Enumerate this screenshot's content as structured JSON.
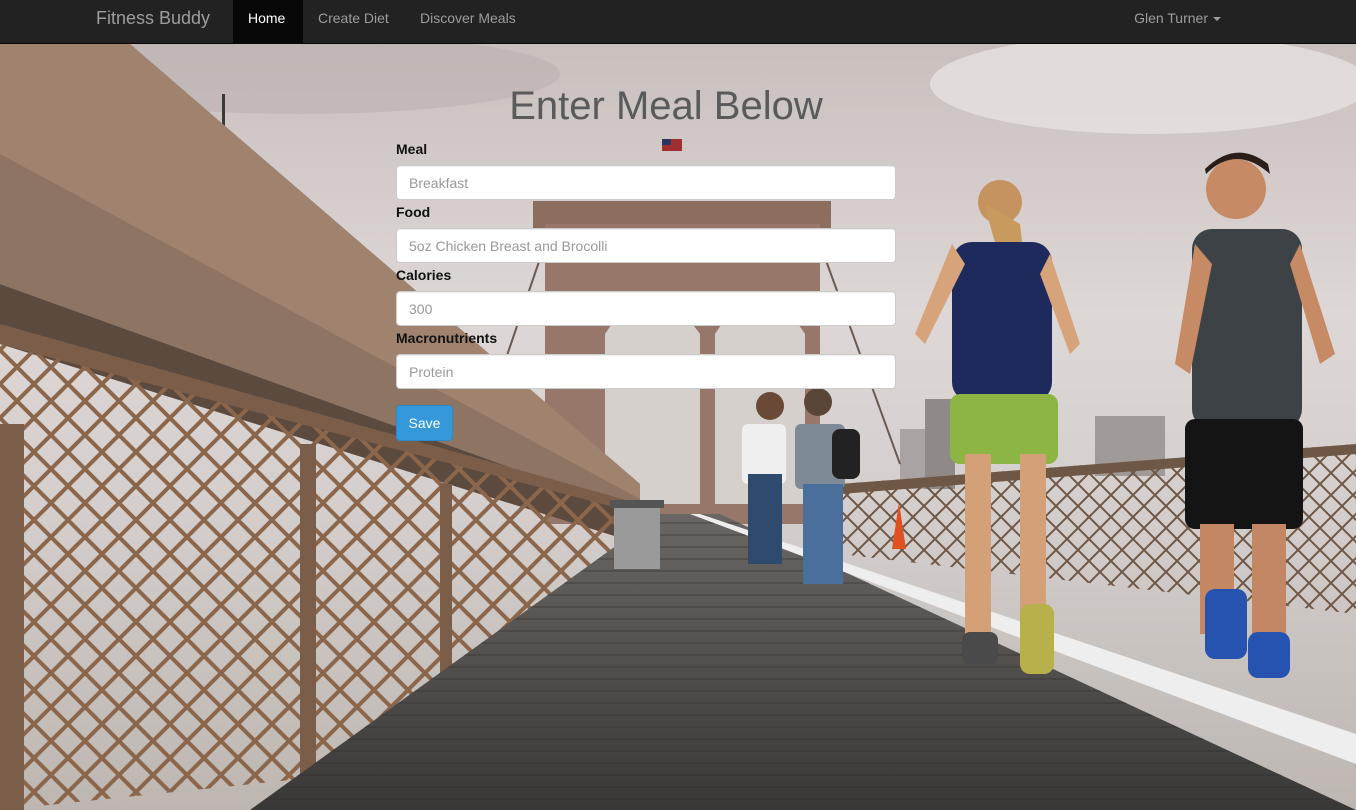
{
  "navbar": {
    "brand": "Fitness Buddy",
    "items": [
      {
        "label": "Home",
        "active": true
      },
      {
        "label": "Create Diet",
        "active": false
      },
      {
        "label": "Discover Meals",
        "active": false
      }
    ],
    "user": "Glen Turner"
  },
  "form": {
    "title": "Enter Meal Below",
    "fields": [
      {
        "label": "Meal",
        "placeholder": "Breakfast",
        "value": ""
      },
      {
        "label": "Food",
        "placeholder": "5oz Chicken Breast and Brocolli",
        "value": ""
      },
      {
        "label": "Calories",
        "placeholder": "300",
        "value": ""
      },
      {
        "label": "Macronutrients",
        "placeholder": "Protein",
        "value": ""
      }
    ],
    "save_label": "Save"
  },
  "background": {
    "description_icon": "bridge-joggers-photo",
    "colors": {
      "sky": "#d9d4d3",
      "railing": "#8a6a52",
      "deck": "#4d4b49"
    }
  },
  "colors": {
    "navbar_bg": "#222222",
    "nav_active_bg": "#080808",
    "accent": "#3498db"
  }
}
